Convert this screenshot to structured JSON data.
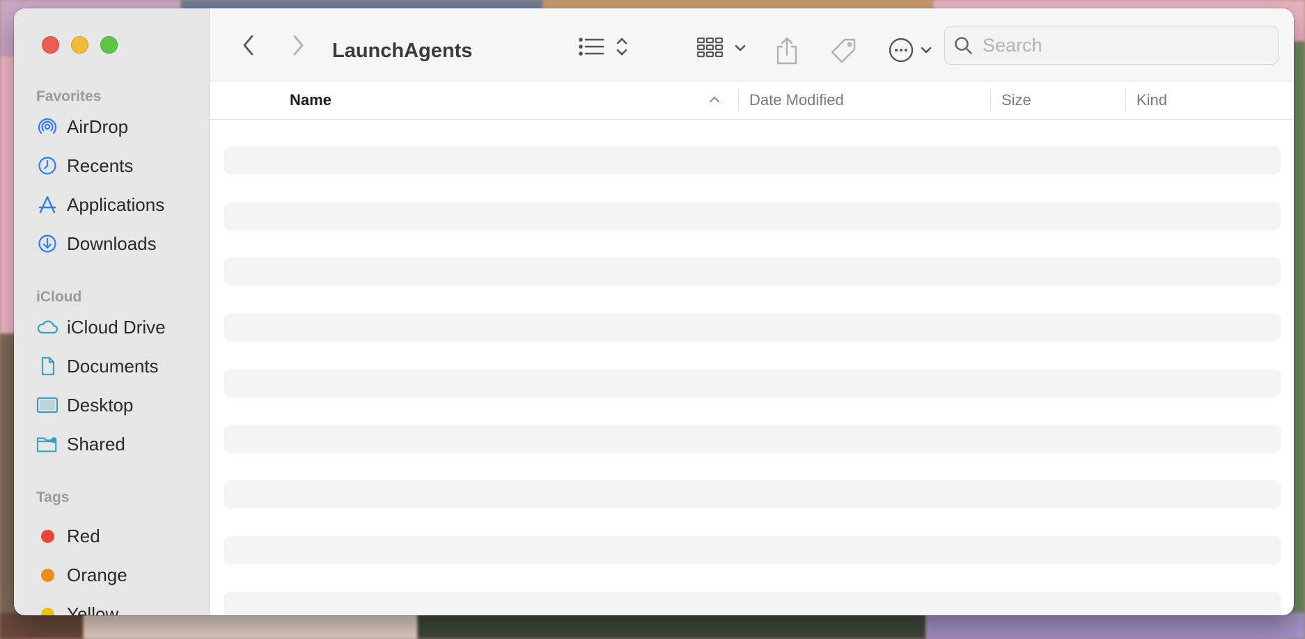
{
  "window": {
    "title": "LaunchAgents"
  },
  "sidebar": {
    "sections": [
      {
        "heading": "Favorites",
        "items": [
          {
            "label": "AirDrop",
            "icon": "airdrop-icon"
          },
          {
            "label": "Recents",
            "icon": "clock-icon"
          },
          {
            "label": "Applications",
            "icon": "applications-icon"
          },
          {
            "label": "Downloads",
            "icon": "download-icon"
          }
        ]
      },
      {
        "heading": "iCloud",
        "items": [
          {
            "label": "iCloud Drive",
            "icon": "cloud-icon"
          },
          {
            "label": "Documents",
            "icon": "document-icon"
          },
          {
            "label": "Desktop",
            "icon": "desktop-icon"
          },
          {
            "label": "Shared",
            "icon": "shared-folder-icon"
          }
        ]
      },
      {
        "heading": "Tags",
        "items": [
          {
            "label": "Red",
            "icon": "tag-dot-icon",
            "color": "#f0433a"
          },
          {
            "label": "Orange",
            "icon": "tag-dot-icon",
            "color": "#f08a1d"
          },
          {
            "label": "Yellow",
            "icon": "tag-dot-icon",
            "color": "#e9c214"
          }
        ]
      }
    ]
  },
  "toolbar": {
    "search": {
      "placeholder": "Search",
      "value": ""
    },
    "icons": [
      "back-icon",
      "forward-icon",
      "list-view-icon",
      "grid-view-icon",
      "share-icon",
      "tag-icon",
      "more-icon",
      "search-icon"
    ]
  },
  "columns": [
    {
      "label": "Name",
      "sorted": "ascending"
    },
    {
      "label": "Date Modified"
    },
    {
      "label": "Size"
    },
    {
      "label": "Kind"
    }
  ],
  "colors": {
    "accent": "#2f7df6",
    "sidebar_bg": "#e6e6e6",
    "placeholder_row": "#f3f4f4"
  }
}
